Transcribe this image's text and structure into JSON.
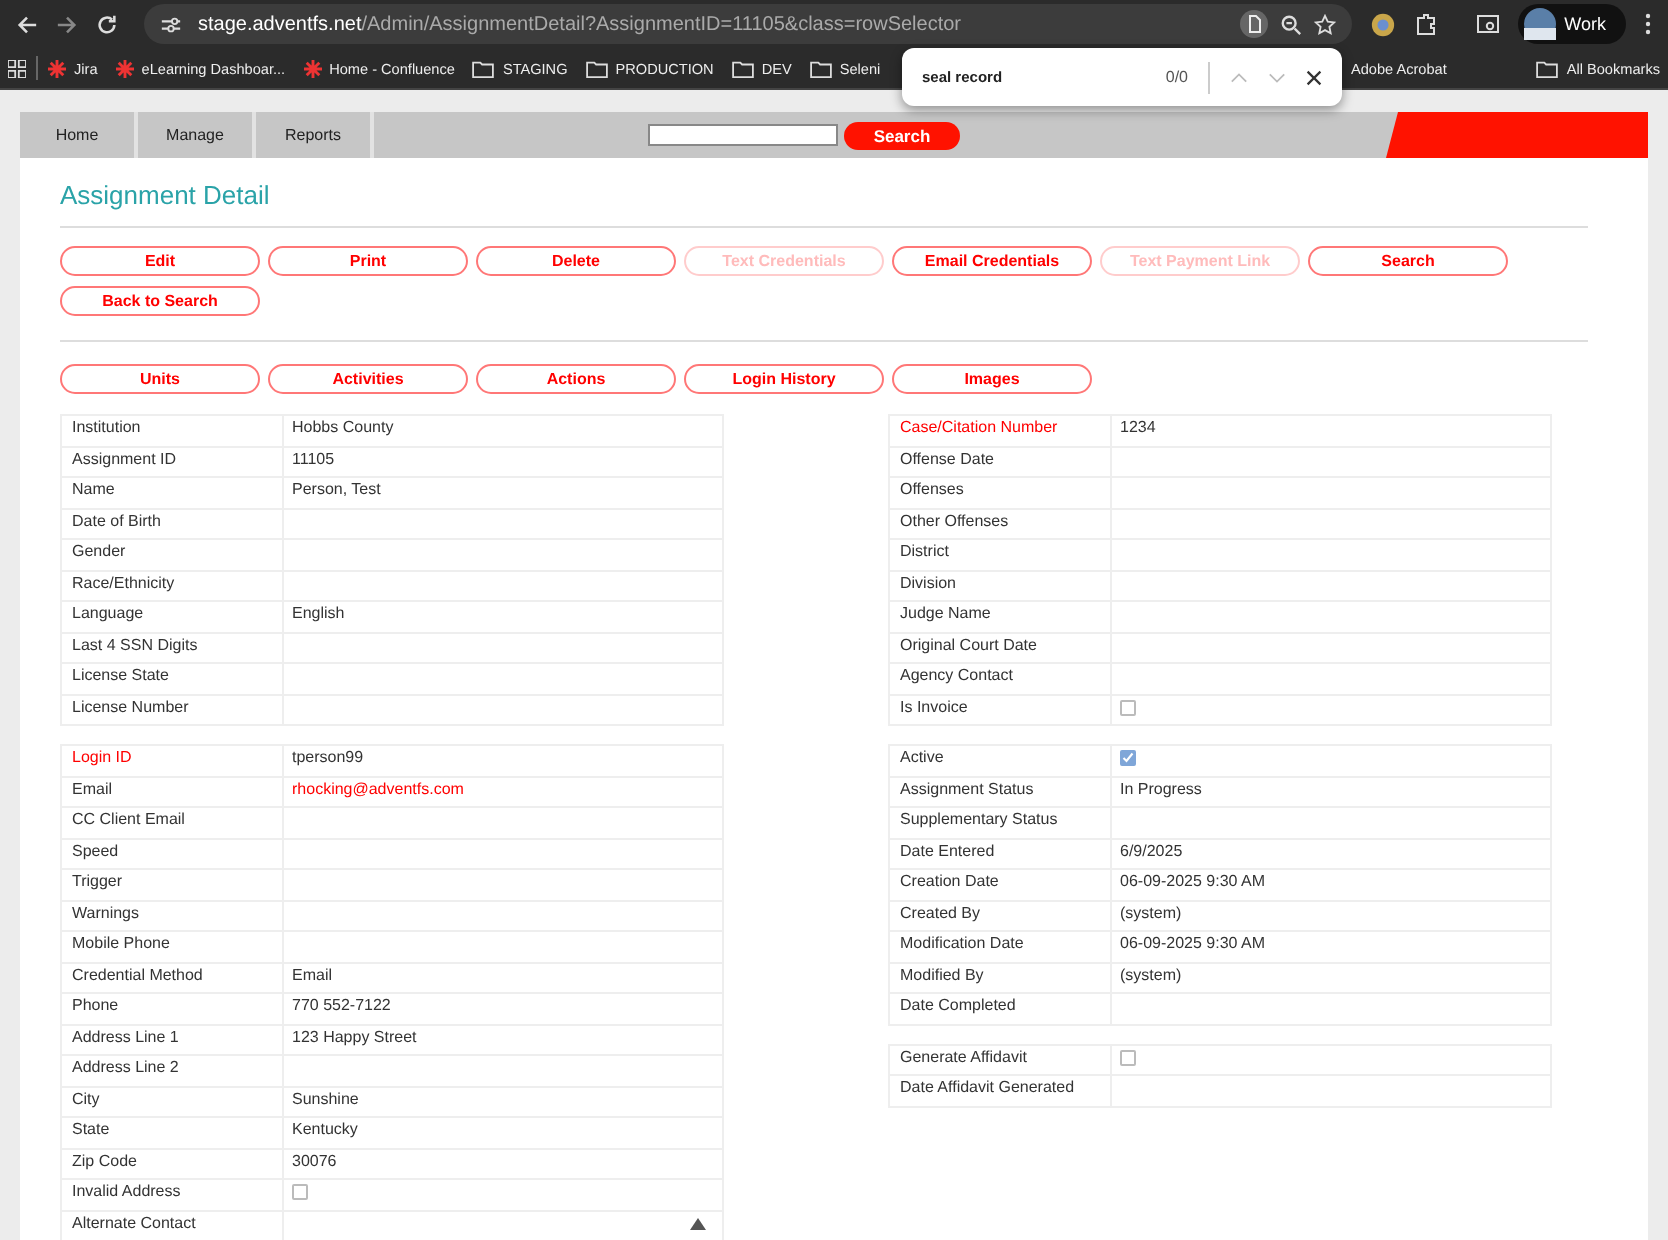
{
  "browser": {
    "url_host": "stage.adventfs.net",
    "url_path": "/Admin/AssignmentDetail?AssignmentID=11105&class=rowSelector",
    "profile": "Work",
    "bookmarks": [
      {
        "label": "Jira",
        "kind": "site"
      },
      {
        "label": "eLearning Dashboar...",
        "kind": "site"
      },
      {
        "label": "Home - Confluence",
        "kind": "site"
      },
      {
        "label": "STAGING",
        "kind": "folder"
      },
      {
        "label": "PRODUCTION",
        "kind": "folder"
      },
      {
        "label": "DEV",
        "kind": "folder"
      },
      {
        "label": "Seleni",
        "kind": "folder"
      },
      {
        "label": "Adobe Acrobat",
        "kind": "plain"
      }
    ],
    "all_bookmarks": "All Bookmarks",
    "find_bar": {
      "value": "seal record",
      "count": "0/0"
    }
  },
  "nav": {
    "items": [
      "Home",
      "Manage",
      "Reports"
    ],
    "search_button": "Search"
  },
  "page_title": "Assignment Detail",
  "actions": [
    {
      "label": "Edit",
      "disabled": false
    },
    {
      "label": "Print",
      "disabled": false
    },
    {
      "label": "Delete",
      "disabled": false
    },
    {
      "label": "Text Credentials",
      "disabled": true
    },
    {
      "label": "Email Credentials",
      "disabled": false
    },
    {
      "label": "Text Payment Link",
      "disabled": true
    },
    {
      "label": "Search",
      "disabled": false
    },
    {
      "label": "Back to Search",
      "disabled": false
    }
  ],
  "tabs": [
    "Units",
    "Activities",
    "Actions",
    "Login History",
    "Images"
  ],
  "left_tables": [
    {
      "rows": [
        {
          "label": "Institution",
          "value": "Hobbs County",
          "kind": "text",
          "required": false
        },
        {
          "label": "Assignment ID",
          "value": "11105",
          "kind": "text",
          "required": false
        },
        {
          "label": "Name",
          "value": "Person, Test",
          "kind": "text",
          "required": false
        },
        {
          "label": "Date of Birth",
          "kind": "text",
          "required": false
        },
        {
          "label": "Gender",
          "kind": "text",
          "required": false
        },
        {
          "label": "Race/Ethnicity",
          "kind": "text",
          "required": false
        },
        {
          "label": "Language",
          "value": "English",
          "kind": "text",
          "required": false
        },
        {
          "label": "Last 4 SSN Digits",
          "kind": "text",
          "required": false
        },
        {
          "label": "License State",
          "kind": "text",
          "required": false
        },
        {
          "label": "License Number",
          "kind": "text",
          "required": false
        }
      ]
    },
    {
      "rows": [
        {
          "label": "Login ID",
          "value": "tperson99",
          "kind": "text",
          "required": true
        },
        {
          "label": "Email",
          "value": "rhocking@adventfs.com",
          "kind": "link",
          "required": false
        },
        {
          "label": "CC Client Email",
          "kind": "text",
          "required": false
        },
        {
          "label": "Speed",
          "kind": "text",
          "required": false
        },
        {
          "label": "Trigger",
          "kind": "text",
          "required": false
        },
        {
          "label": "Warnings",
          "kind": "text",
          "required": false
        },
        {
          "label": "Mobile Phone",
          "kind": "text",
          "required": false
        },
        {
          "label": "Credential Method",
          "value": "Email",
          "kind": "text",
          "required": false
        },
        {
          "label": "Phone",
          "value": "770 552-7122",
          "kind": "text",
          "required": false
        },
        {
          "label": "Address Line 1",
          "value": "123 Happy Street",
          "kind": "text",
          "required": false
        },
        {
          "label": "Address Line 2",
          "kind": "text",
          "required": false
        },
        {
          "label": "City",
          "value": "Sunshine",
          "kind": "text",
          "required": false
        },
        {
          "label": "State",
          "value": "Kentucky",
          "kind": "text",
          "required": false
        },
        {
          "label": "Zip Code",
          "value": "30076",
          "kind": "text",
          "required": false
        },
        {
          "label": "Invalid Address",
          "kind": "checkbox",
          "checked": false,
          "required": false
        },
        {
          "label": "Alternate Contact",
          "kind": "textarea",
          "required": false
        }
      ]
    }
  ],
  "right_tables": [
    {
      "rows": [
        {
          "label": "Case/Citation Number",
          "value": "1234",
          "kind": "text",
          "required": true
        },
        {
          "label": "Offense Date",
          "kind": "text",
          "required": false
        },
        {
          "label": "Offenses",
          "kind": "text",
          "required": false
        },
        {
          "label": "Other Offenses",
          "kind": "text",
          "required": false
        },
        {
          "label": "District",
          "kind": "text",
          "required": false
        },
        {
          "label": "Division",
          "kind": "text",
          "required": false
        },
        {
          "label": "Judge Name",
          "kind": "text",
          "required": false
        },
        {
          "label": "Original Court Date",
          "kind": "text",
          "required": false
        },
        {
          "label": "Agency Contact",
          "kind": "text",
          "required": false
        },
        {
          "label": "Is Invoice",
          "kind": "checkbox",
          "checked": false,
          "required": false
        }
      ]
    },
    {
      "rows": [
        {
          "label": "Active",
          "kind": "checkbox",
          "checked": true,
          "required": false
        },
        {
          "label": "Assignment Status",
          "value": "In Progress",
          "kind": "text",
          "required": false
        },
        {
          "label": "Supplementary Status",
          "kind": "text",
          "required": false
        },
        {
          "label": "Date Entered",
          "value": "6/9/2025",
          "kind": "text",
          "required": false
        },
        {
          "label": "Creation Date",
          "value": "06-09-2025 9:30 AM",
          "kind": "text",
          "required": false
        },
        {
          "label": "Created By",
          "value": "(system)",
          "kind": "text",
          "required": false
        },
        {
          "label": "Modification Date",
          "value": "06-09-2025 9:30 AM",
          "kind": "text",
          "required": false
        },
        {
          "label": "Modified By",
          "value": "(system)",
          "kind": "text",
          "required": false
        },
        {
          "label": "Date Completed",
          "kind": "text",
          "required": false
        }
      ]
    },
    {
      "rows": [
        {
          "label": "Generate Affidavit",
          "kind": "checkbox",
          "checked": false,
          "required": false
        },
        {
          "label": "Date Affidavit Generated",
          "kind": "text",
          "required": false
        }
      ]
    }
  ]
}
